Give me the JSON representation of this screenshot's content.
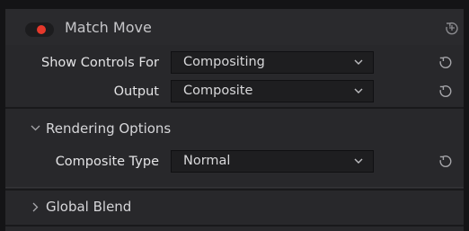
{
  "header": {
    "title": "Match Move",
    "enabled": true
  },
  "controls": {
    "show_controls_for": {
      "label": "Show Controls For",
      "value": "Compositing"
    },
    "output": {
      "label": "Output",
      "value": "Composite"
    }
  },
  "sections": {
    "rendering_options": {
      "label": "Rendering Options",
      "expanded": true
    },
    "global_blend": {
      "label": "Global Blend",
      "expanded": false
    }
  },
  "rendering": {
    "composite_type": {
      "label": "Composite Type",
      "value": "Normal"
    }
  },
  "icons": {
    "toggle": "toggle-switch",
    "reset": "reset-icon",
    "chevron_down": "chevron-down-icon",
    "chevron_right": "chevron-right-icon"
  },
  "colors": {
    "accent": "#e5382b",
    "panel": "#28282b",
    "field": "#1e1e20"
  }
}
